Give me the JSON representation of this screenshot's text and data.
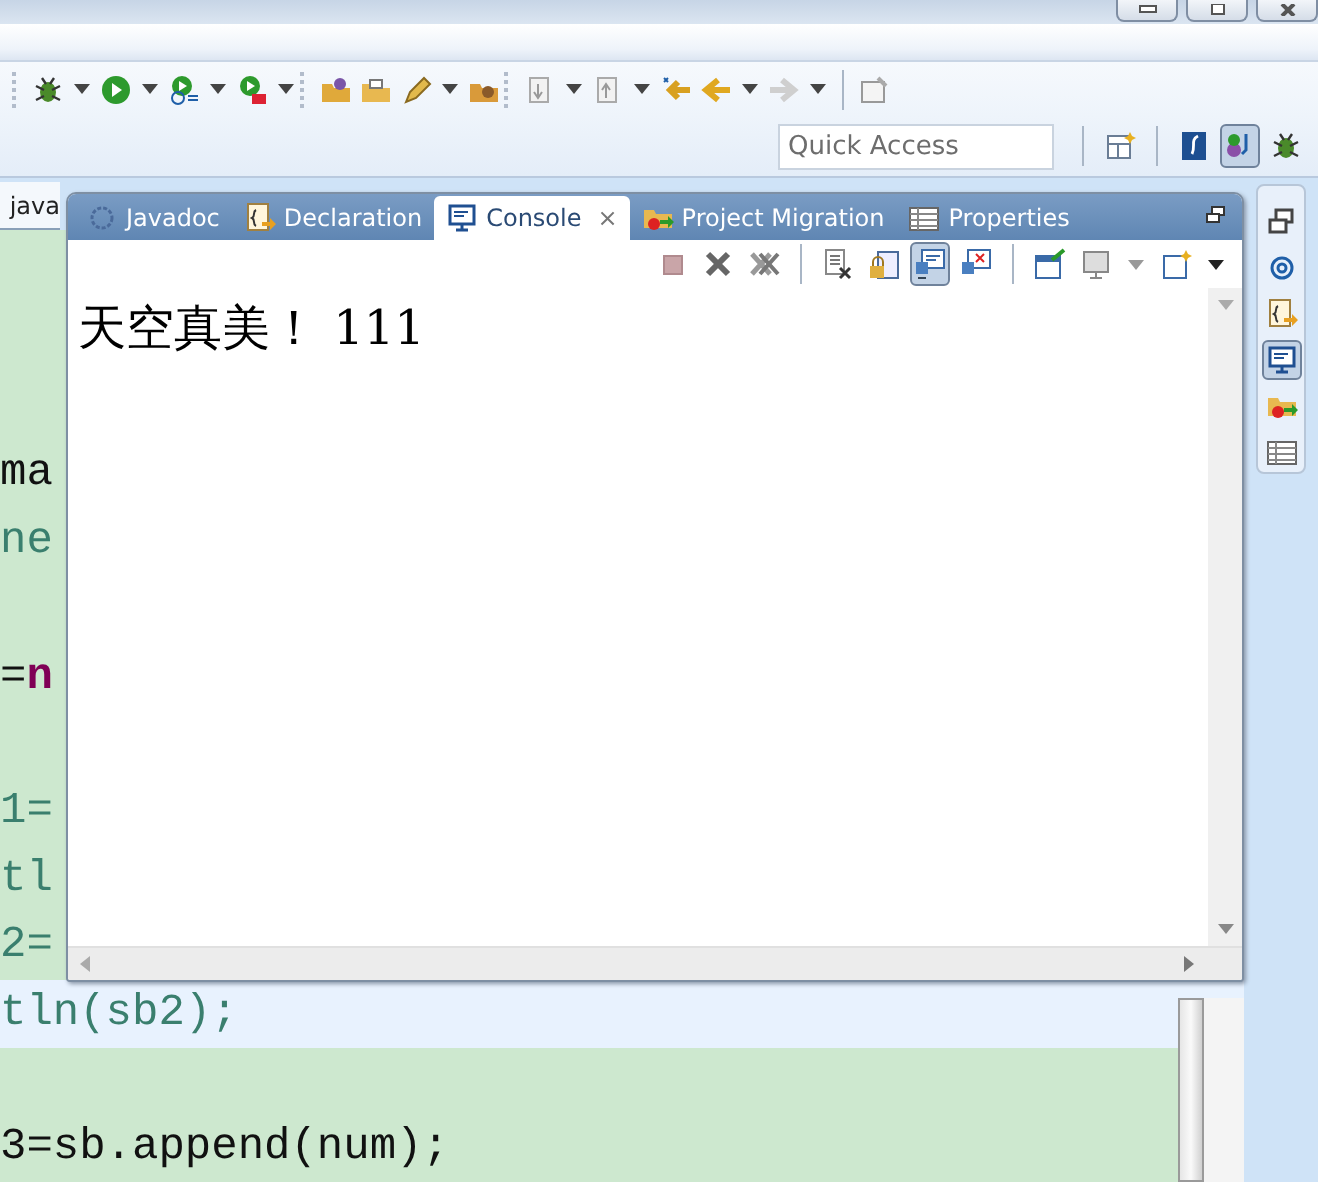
{
  "quick_access": {
    "placeholder": "Quick Access"
  },
  "perspectives": [
    {
      "selected": false
    },
    {
      "selected": true
    },
    {
      "selected": false
    }
  ],
  "editor": {
    "tab": {
      "label": "java"
    },
    "lines": [
      {
        "kind": "code",
        "current": false,
        "segments": [
          {
            "kind": "plain",
            "text": "ma"
          }
        ]
      },
      {
        "kind": "code",
        "current": false,
        "segments": [
          {
            "kind": "field",
            "text": "ne"
          }
        ]
      },
      {
        "kind": "blank"
      },
      {
        "kind": "code",
        "current": false,
        "segments": [
          {
            "kind": "plain",
            "text": "="
          },
          {
            "kind": "keyword",
            "text": "n"
          }
        ]
      },
      {
        "kind": "blank"
      },
      {
        "kind": "code",
        "current": false,
        "segments": [
          {
            "kind": "field",
            "text": "1="
          }
        ]
      },
      {
        "kind": "code",
        "current": false,
        "segments": [
          {
            "kind": "field",
            "text": "tl"
          }
        ]
      },
      {
        "kind": "code",
        "current": false,
        "segments": [
          {
            "kind": "field",
            "text": "2="
          }
        ]
      },
      {
        "kind": "code",
        "current": true,
        "segments": [
          {
            "kind": "field",
            "text": "tln(sb2);"
          }
        ]
      },
      {
        "kind": "blank"
      },
      {
        "kind": "code",
        "current": false,
        "segments": [
          {
            "kind": "plain",
            "text": "3=sb.append(num);"
          }
        ]
      }
    ]
  },
  "console_view": {
    "tabs": [
      {
        "label": "Javadoc",
        "selected": false
      },
      {
        "label": "Declaration",
        "selected": false
      },
      {
        "label": "Console",
        "selected": true,
        "close": "×"
      },
      {
        "label": "Project Migration",
        "selected": false
      },
      {
        "label": "Properties",
        "selected": false
      }
    ],
    "toolbar": [
      {
        "pressed": false
      },
      {
        "pressed": false
      },
      {
        "pressed": false
      },
      {
        "pressed": false
      },
      {
        "pressed": false
      },
      {
        "pressed": true
      },
      {
        "pressed": false
      },
      {
        "pressed": false
      },
      {
        "pressed": false
      },
      {
        "pressed": false
      }
    ],
    "output": [
      "天空真美！ 111"
    ]
  },
  "trim_stack": {
    "items": [
      {
        "selected": false
      },
      {
        "selected": false
      },
      {
        "selected": false
      },
      {
        "selected": true
      },
      {
        "selected": false
      },
      {
        "selected": false
      }
    ]
  }
}
